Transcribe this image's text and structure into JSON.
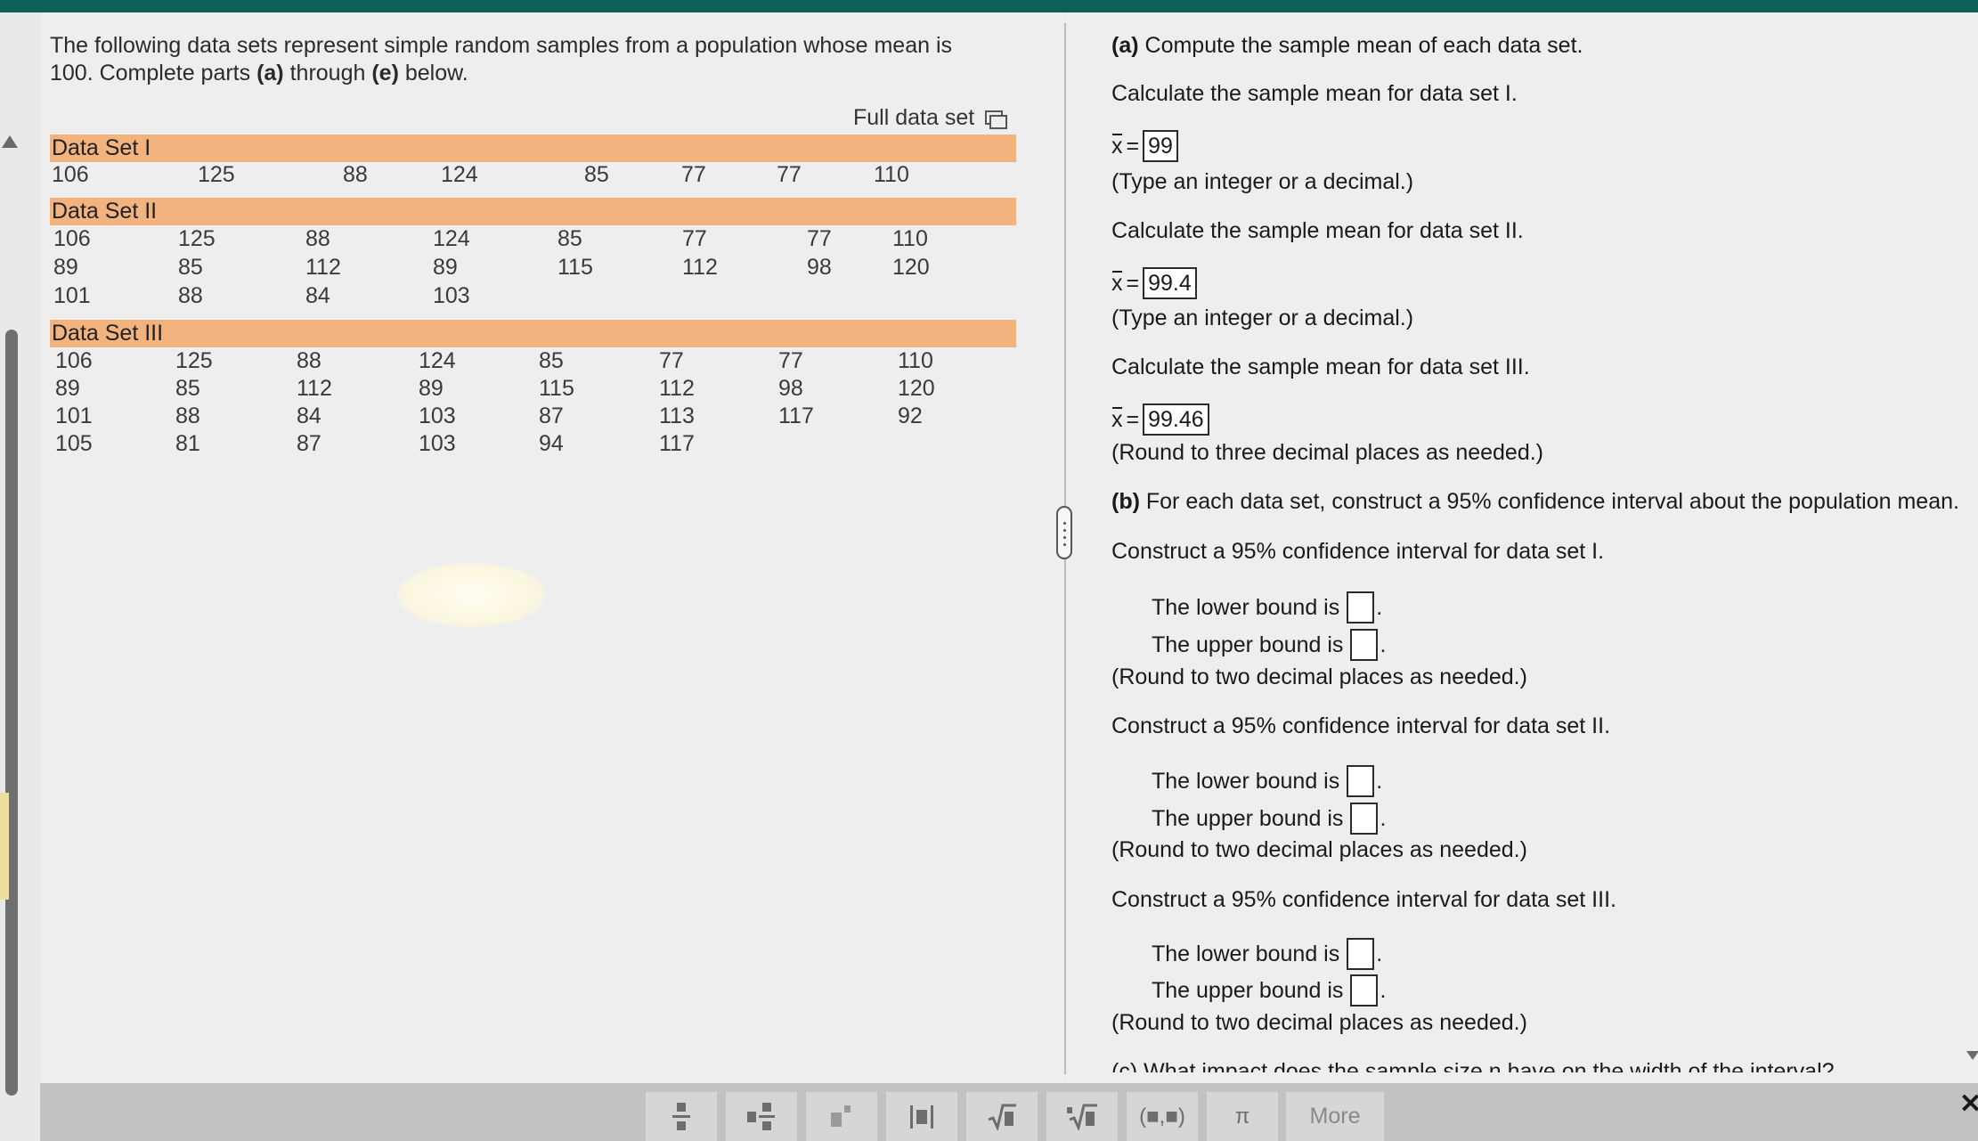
{
  "problem": {
    "text": "The following data sets represent simple random samples from a population whose mean is 100. Complete parts",
    "part_a": "(a)",
    "through": "through",
    "part_e": "(e)",
    "below": "below."
  },
  "full_data_set_label": "Full data set",
  "data_set_1": {
    "title": "Data Set I",
    "rows": [
      [
        "106",
        "125",
        "88",
        "124",
        "85",
        "77",
        "77",
        "110"
      ]
    ]
  },
  "data_set_2": {
    "title": "Data Set II",
    "rows": [
      [
        "106",
        "125",
        "88",
        "124",
        "85",
        "77",
        "77",
        "110"
      ],
      [
        "89",
        "85",
        "112",
        "89",
        "115",
        "112",
        "98",
        "120"
      ],
      [
        "101",
        "88",
        "84",
        "103"
      ]
    ]
  },
  "data_set_3": {
    "title": "Data Set III",
    "rows": [
      [
        "106",
        "125",
        "88",
        "124",
        "85",
        "77",
        "77",
        "110"
      ],
      [
        "89",
        "85",
        "112",
        "89",
        "115",
        "112",
        "98",
        "120"
      ],
      [
        "101",
        "88",
        "84",
        "103",
        "87",
        "113",
        "117",
        "92"
      ],
      [
        "105",
        "81",
        "87",
        "103",
        "94",
        "117"
      ]
    ]
  },
  "part_a": {
    "label": "(a)",
    "text": "Compute the sample mean of each data set.",
    "set1_prompt": "Calculate the sample mean for data set I.",
    "xbar_symbol": "x",
    "equals": "=",
    "set1_answer": "99",
    "set1_hint": "(Type an integer or a decimal.)",
    "set2_prompt": "Calculate the sample mean for data set II.",
    "set2_answer": "99.4",
    "set2_hint": "(Type an integer or a decimal.)",
    "set3_prompt": "Calculate the sample mean for data set III.",
    "set3_answer": "99.46",
    "set3_hint": "(Round to three decimal places as needed.)"
  },
  "part_b": {
    "label": "(b)",
    "text": "For each data set, construct a 95% confidence interval about the population mean.",
    "set1_prompt": "Construct a 95% confidence interval for data set I.",
    "set2_prompt": "Construct a 95% confidence interval for data set II.",
    "set3_prompt": "Construct a 95% confidence interval for data set III.",
    "lower_label": "The lower bound is",
    "upper_label": "The upper bound is",
    "period": ".",
    "hint": "(Round to two decimal places as needed.)"
  },
  "part_c_cut": "(c) What impact does the sample size n have on the width of the interval?",
  "toolbar": {
    "tools": [
      "fraction-tool",
      "mixed-number-tool",
      "exponent-tool",
      "absolute-value-tool",
      "square-root-tool",
      "nth-root-tool",
      "interval-tool",
      "pi-tool"
    ],
    "pi": "π",
    "interval": "(■,■)",
    "more": "More",
    "close": "✕"
  }
}
